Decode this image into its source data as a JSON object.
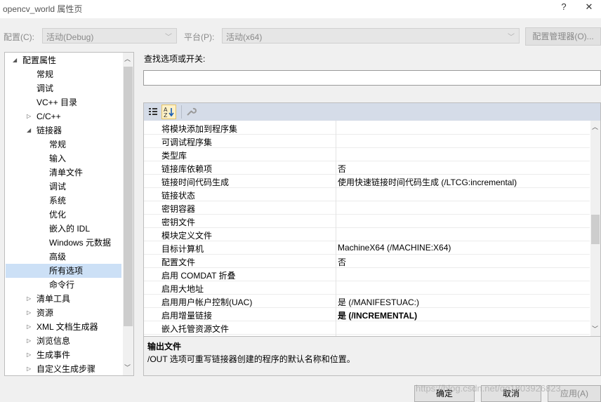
{
  "window": {
    "title": "opencv_world 属性页",
    "help": "?",
    "close": "✕"
  },
  "config": {
    "config_label": "配置(C):",
    "config_value": "活动(Debug)",
    "platform_label": "平台(P):",
    "platform_value": "活动(x64)",
    "manager_button": "配置管理器(O)..."
  },
  "tree": {
    "items": [
      {
        "label": "配置属性"
      },
      {
        "label": "常规"
      },
      {
        "label": "调试"
      },
      {
        "label": "VC++ 目录"
      },
      {
        "label": "C/C++"
      },
      {
        "label": "链接器"
      },
      {
        "label": "常规"
      },
      {
        "label": "输入"
      },
      {
        "label": "清单文件"
      },
      {
        "label": "调试"
      },
      {
        "label": "系统"
      },
      {
        "label": "优化"
      },
      {
        "label": "嵌入的 IDL"
      },
      {
        "label": "Windows 元数据"
      },
      {
        "label": "高级"
      },
      {
        "label": "所有选项"
      },
      {
        "label": "命令行"
      },
      {
        "label": "清单工具"
      },
      {
        "label": "资源"
      },
      {
        "label": "XML 文档生成器"
      },
      {
        "label": "浏览信息"
      },
      {
        "label": "生成事件"
      },
      {
        "label": "自定义生成步骤"
      }
    ]
  },
  "search": {
    "label": "查找选项或开关:",
    "value": ""
  },
  "grid": {
    "rows": [
      {
        "name": "将模块添加到程序集",
        "value": ""
      },
      {
        "name": "可调试程序集",
        "value": ""
      },
      {
        "name": "类型库",
        "value": ""
      },
      {
        "name": "链接库依赖项",
        "value": "否"
      },
      {
        "name": "链接时间代码生成",
        "value": "使用快速链接时间代码生成 (/LTCG:incremental)"
      },
      {
        "name": "链接状态",
        "value": ""
      },
      {
        "name": "密钥容器",
        "value": ""
      },
      {
        "name": "密钥文件",
        "value": ""
      },
      {
        "name": "模块定义文件",
        "value": ""
      },
      {
        "name": "目标计算机",
        "value": "MachineX64 (/MACHINE:X64)"
      },
      {
        "name": "配置文件",
        "value": "否"
      },
      {
        "name": "启用 COMDAT 折叠",
        "value": ""
      },
      {
        "name": "启用大地址",
        "value": ""
      },
      {
        "name": "启用用户帐户控制(UAC)",
        "value": "是 (/MANIFESTUAC:)"
      },
      {
        "name": "启用增量链接",
        "value": "是 (/INCREMENTAL)"
      },
      {
        "name": "嵌入托管资源文件",
        "value": ""
      }
    ]
  },
  "description": {
    "title": "输出文件",
    "text": "/OUT 选项可重写链接器创建的程序的默认名称和位置。"
  },
  "buttons": {
    "ok": "确定",
    "cancel": "取消",
    "apply": "应用(A)"
  },
  "watermark": "https://blog.csdn.net/qq1803926823",
  "icons": {
    "sort_category": "categorized-icon",
    "sort_alpha": "alphabetical-icon",
    "property_pages": "wrench-icon"
  }
}
